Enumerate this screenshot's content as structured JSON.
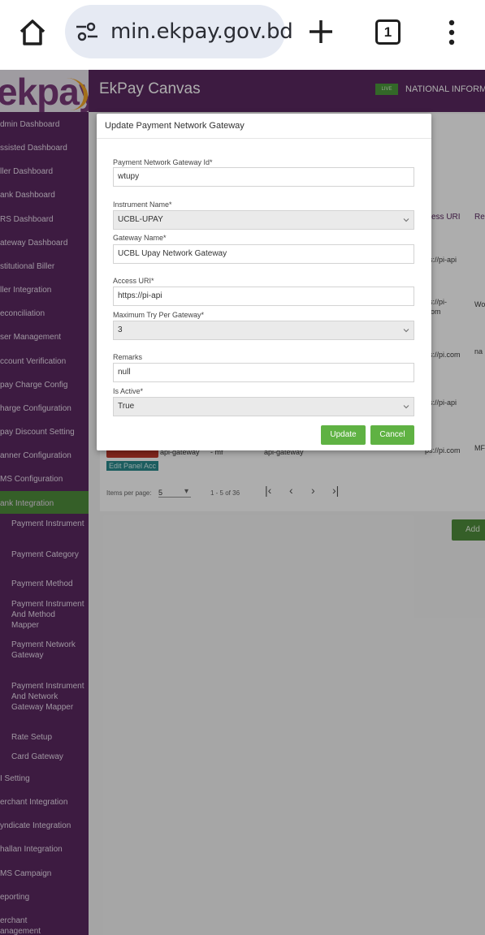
{
  "browser": {
    "url": "min.ekpay.gov.bd",
    "tab_count": "1",
    "icons": [
      "home-icon",
      "tune-icon",
      "plus-icon",
      "tabs-icon",
      "more-vert-icon"
    ]
  },
  "app": {
    "logo": "ekpay",
    "title": "EkPay Canvas",
    "badge": "LIVE",
    "org": "NATIONAL INFORMAT",
    "colors": {
      "brand_purple": "#5a2860",
      "accent_green": "#5fb243",
      "active_green": "#4f8c3c",
      "logo_orange": "#f0a528"
    }
  },
  "sidebar": {
    "items": [
      "dmin Dashboard",
      "ssisted Dashboard",
      "ller Dashboard",
      "ank Dashboard",
      "RS Dashboard",
      "ateway Dashboard",
      "stitutional Biller",
      "ller Integration",
      "econciliation",
      "ser Management",
      "ccount Verification",
      "pay Charge Config",
      "harge Configuration",
      "pay Discount Setting",
      "anner Configuration",
      "MS Configuration",
      "ank Integration"
    ],
    "sub_items": [
      "Payment Instrument",
      "Payment Category",
      "Payment Method",
      "Payment Instrument And Method Mapper",
      "Payment Network Gateway",
      "Payment Instrument And Network Gateway Mapper",
      "Rate Setup",
      "Card Gateway"
    ],
    "items_after": [
      "I Setting",
      "erchant Integration",
      "yndicate Integration",
      "hallan Integration",
      "MS Campaign",
      "eporting",
      "erchant anagement"
    ]
  },
  "table": {
    "col_access_uri": "ccess URI",
    "col_remarks": "Re",
    "cells": [
      "ps://pi-api",
      "ps://pi-",
      ".com",
      "Wo",
      "ps://pi.com",
      "na",
      "ps://pi-api",
      "ps://pi.com",
      "MF",
      "api-gateway",
      "- mf",
      "api-gateway",
      "Edit Panel Acc"
    ],
    "items_per_page_label": "Items per page:",
    "items_per_page": "5",
    "range": "1 - 5 of 36",
    "pager_icons": [
      "first-page-icon",
      "prev-page-icon",
      "next-page-icon",
      "last-page-icon"
    ],
    "add_button": "Add"
  },
  "modal": {
    "title": "Update Payment Network Gateway",
    "fields": {
      "gateway_id": {
        "label": "Payment Network Gateway Id*",
        "value": "wtupy"
      },
      "instrument_name": {
        "label": "Instrument Name*",
        "value": "UCBL-UPAY"
      },
      "gateway_name": {
        "label": "Gateway Name*",
        "value": "UCBL Upay Network Gateway"
      },
      "access_uri": {
        "label": "Access URI*",
        "value": "https://pi-api"
      },
      "max_try": {
        "label": "Maximum Try Per Gateway*",
        "value": "3"
      },
      "remarks": {
        "label": "Remarks",
        "value": "null"
      },
      "is_active": {
        "label": "Is Active*",
        "value": "True"
      }
    },
    "update_label": "Update",
    "cancel_label": "Cancel"
  }
}
